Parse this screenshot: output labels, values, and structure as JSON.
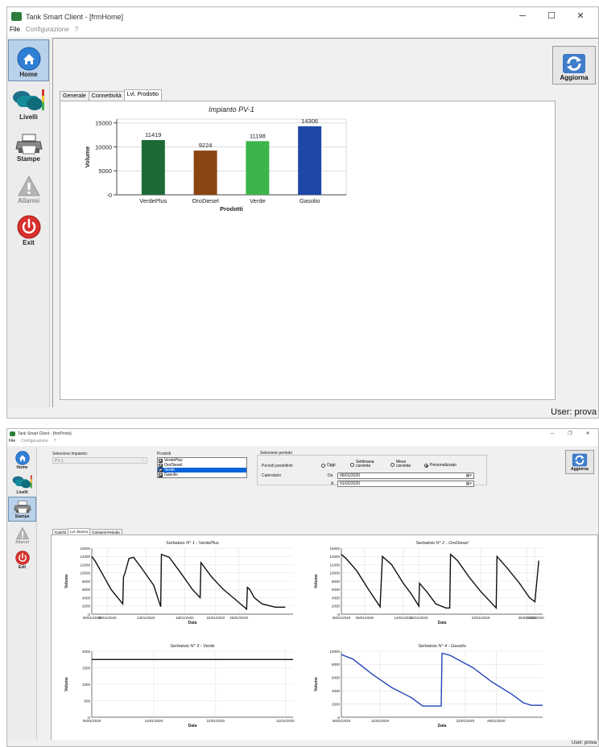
{
  "window1": {
    "title": "Tank Smart Client - [frmHome]",
    "menu": [
      "File",
      "Configurazione",
      "?"
    ],
    "sidebar": [
      {
        "label": "Home",
        "icon": "home-icon"
      },
      {
        "label": "Livelli",
        "icon": "tanks-icon"
      },
      {
        "label": "Stampe",
        "icon": "printer-icon"
      },
      {
        "label": "Allarmi",
        "icon": "warning-icon"
      },
      {
        "label": "Exit",
        "icon": "power-icon"
      }
    ],
    "refresh_label": "Aggiorna",
    "tabs": [
      "Generale",
      "Connettività",
      "Lvl. Prodotto"
    ],
    "active_tab": 2,
    "status": "User: prova",
    "chart_data": {
      "type": "bar",
      "title": "Impianto PV-1",
      "xlabel": "Prodotti",
      "ylabel": "Volume",
      "categories": [
        "VerdePlus",
        "OroDiesel",
        "Verde",
        "Gasolio"
      ],
      "values": [
        11419,
        9224,
        11198,
        14306
      ],
      "colors": [
        "#1e6a37",
        "#8b4513",
        "#3cb44b",
        "#1f47a8"
      ],
      "yticks": [
        "15000",
        "10000",
        "5000",
        "0"
      ],
      "ylim": [
        0,
        15000
      ],
      "grid": true
    }
  },
  "window2": {
    "title": "Tank Smart Client - [frmPrints]",
    "menu": [
      "File",
      "Configurazione",
      "?"
    ],
    "sidebar": [
      {
        "label": "Home",
        "icon": "home-icon"
      },
      {
        "label": "Livelli",
        "icon": "tanks-icon"
      },
      {
        "label": "Stampe",
        "icon": "printer-icon"
      },
      {
        "label": "Allarmi",
        "icon": "warning-icon"
      },
      {
        "label": "Exit",
        "icon": "power-icon"
      }
    ],
    "selected_sidebar": 2,
    "refresh_label": "Aggiorna",
    "impianto_label": "Seleziona Impianto:",
    "impianto_value": "PV-1",
    "prodotti_label": "Prodotti",
    "prodotti": [
      {
        "label": "VerdePlus",
        "checked": true,
        "selected": false
      },
      {
        "label": "OroDiesel",
        "checked": true,
        "selected": false
      },
      {
        "label": "Verde",
        "checked": true,
        "selected": true
      },
      {
        "label": "Gasolio",
        "checked": true,
        "selected": false
      }
    ],
    "periodo_group": "Selezione periodo",
    "periodi_label": "Periodi predefiniti",
    "radios": [
      {
        "label": "Oggi",
        "on": false
      },
      {
        "label": "Settimana corrente",
        "on": false
      },
      {
        "label": "Mese corrente",
        "on": false
      },
      {
        "label": "Personalizzato",
        "on": true
      }
    ],
    "calendario_label": "Calendario",
    "da_label": "Da",
    "da_value": "06/01/2020",
    "a_label": "A",
    "a_value": "01/02/2020",
    "tabs": [
      "Carichi",
      "Lvl. Storico",
      "Consumi Periodo"
    ],
    "active_tab": 1,
    "status": "User: prova",
    "chart_data": [
      {
        "type": "line",
        "title": "Serbatoio N° 1 - VerdePlus",
        "xlabel": "Data",
        "ylabel": "Volume",
        "color": "#111111",
        "xticks": [
          "06/01/2020",
          "08/01/2020",
          "13/01/2020",
          "18/01/2020",
          "22/01/2020",
          "25/01/2020"
        ],
        "xtick_days": [
          6,
          8,
          13,
          18,
          22,
          25
        ],
        "yticks": [
          "16000",
          "14000",
          "12000",
          "10000",
          "8000",
          "6000",
          "4000",
          "2000",
          "0"
        ],
        "ylim": [
          0,
          16000
        ],
        "xlim_days": [
          6,
          32
        ],
        "x_days": [
          6,
          6.4,
          7,
          8.5,
          10,
          10.1,
          10.3,
          10.8,
          11.4,
          12.5,
          14,
          14.9,
          15,
          16,
          17.5,
          19,
          20,
          20.1,
          21.5,
          23,
          24.6,
          26,
          26.1,
          26.4,
          27,
          28,
          29.7,
          31
        ],
        "y": [
          14000,
          13000,
          11000,
          6000,
          2500,
          9000,
          10000,
          13500,
          13800,
          11000,
          7000,
          1800,
          14500,
          13800,
          10000,
          6000,
          4000,
          12500,
          9000,
          6000,
          3500,
          1200,
          6500,
          6000,
          4000,
          2500,
          1700,
          1700
        ]
      },
      {
        "type": "line",
        "title": "Serbatoio N° 2 - OroDiesel",
        "xlabel": "Data",
        "ylabel": "Volume",
        "color": "#111111",
        "xticks": [
          "06/01/2020",
          "09/01/2020",
          "14/01/2020",
          "16/01/2020",
          "24/01/2020",
          "30/01/2020",
          "31/01/2020"
        ],
        "xtick_days": [
          6,
          9,
          14,
          16,
          24,
          30,
          31
        ],
        "yticks": [
          "16000",
          "14000",
          "12000",
          "10000",
          "8000",
          "6000",
          "4000",
          "2000",
          "0"
        ],
        "ylim": [
          0,
          16000
        ],
        "xlim_days": [
          6,
          32
        ],
        "x_days": [
          6,
          6.6,
          8,
          9.5,
          11,
          11.3,
          12.5,
          14,
          15,
          16,
          16.1,
          17,
          18.2,
          19.5,
          20,
          20.1,
          21,
          22.5,
          24,
          25.5,
          26,
          26.1,
          27.5,
          29,
          30.3,
          31,
          31.5
        ],
        "y": [
          14500,
          13500,
          10500,
          6000,
          1800,
          14000,
          12000,
          7500,
          5000,
          2000,
          7500,
          5500,
          2500,
          1500,
          1500,
          14500,
          13000,
          9000,
          5500,
          2500,
          1500,
          14000,
          11000,
          7500,
          4000,
          3000,
          13000
        ]
      },
      {
        "type": "line",
        "title": "Serbatoio N° 3 - Verde",
        "xlabel": "Data",
        "ylabel": "Volume",
        "color": "#111111",
        "xticks": [
          "06/01/2020",
          "14/01/2020",
          "22/01/2020",
          "31/01/2020"
        ],
        "xtick_days": [
          6,
          14,
          22,
          31
        ],
        "yticks": [
          "2000",
          "1500",
          "1000",
          "500",
          "0"
        ],
        "ylim": [
          0,
          2000
        ],
        "xlim_days": [
          6,
          32
        ],
        "x_days": [
          6,
          32
        ],
        "y": [
          1750,
          1750
        ]
      },
      {
        "type": "line",
        "title": "Serbatoio N° 4 - Gasolio",
        "xlabel": "Data",
        "ylabel": "Volume",
        "color": "#2446b8",
        "xticks": [
          "06/01/2020",
          "11/01/2020",
          "22/01/2020",
          "26/01/2020"
        ],
        "xtick_days": [
          6,
          11,
          22,
          26
        ],
        "yticks": [
          "10000",
          "8000",
          "6000",
          "4000",
          "2000",
          "0"
        ],
        "ylim": [
          0,
          10000
        ],
        "xlim_days": [
          6,
          32
        ],
        "x_days": [
          6,
          7.5,
          10,
          12.5,
          15,
          16.5,
          17.5,
          18.9,
          19,
          20,
          23,
          25.5,
          28,
          29.5,
          30.5,
          32
        ],
        "y": [
          9500,
          8800,
          6500,
          4500,
          3000,
          1700,
          1700,
          1700,
          9700,
          9400,
          7500,
          5300,
          3500,
          2200,
          1800,
          1800
        ]
      }
    ]
  }
}
